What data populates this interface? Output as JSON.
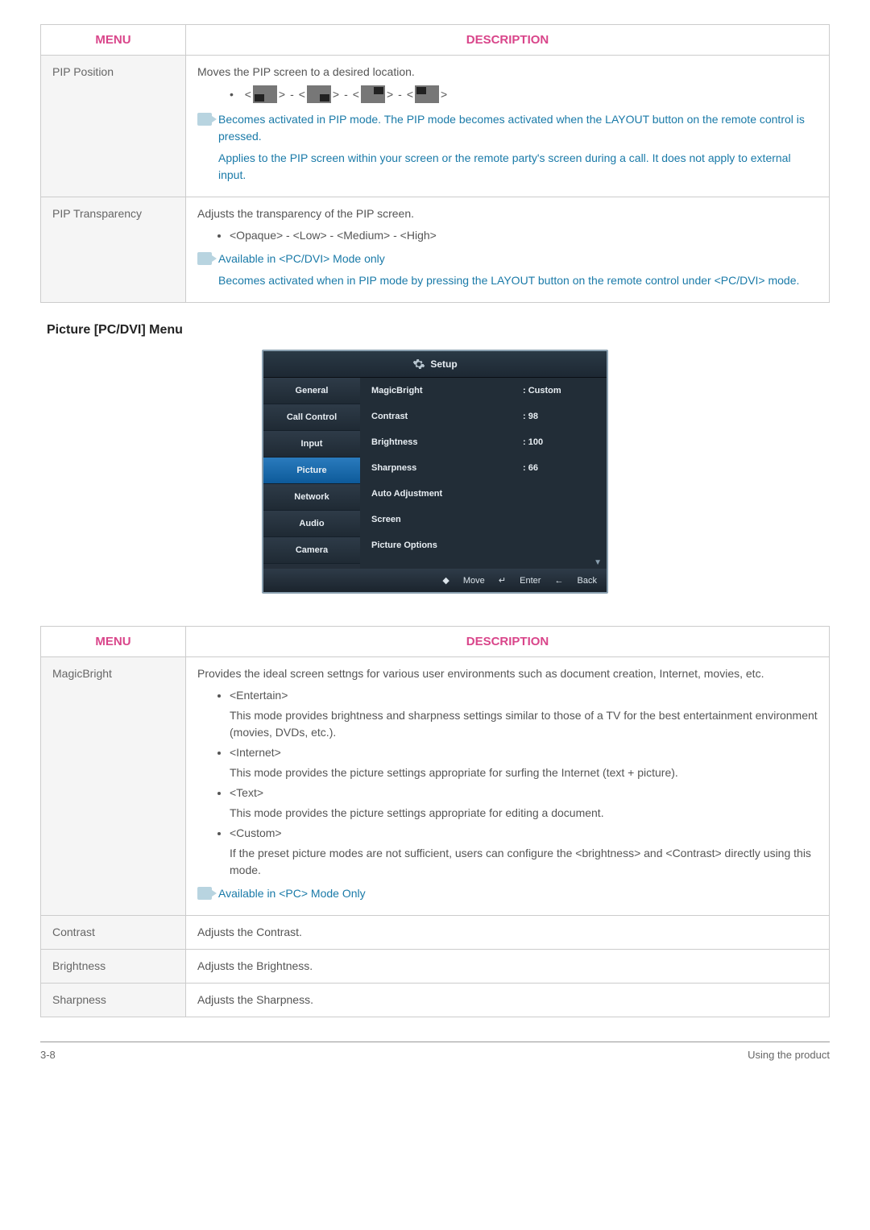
{
  "headers": {
    "menu": "MENU",
    "description": "DESCRIPTION"
  },
  "table1": {
    "rows": [
      {
        "menu": "PIP Position",
        "intro": "Moves the PIP screen to a desired location.",
        "note1": "Becomes activated in PIP mode. The PIP mode becomes activated when the LAYOUT button on the remote control is pressed.",
        "note2": "Applies to the PIP screen within your screen or the remote party's screen during a call. It does not apply to external input."
      },
      {
        "menu": "PIP Transparency",
        "intro": "Adjusts the transparency of the PIP screen.",
        "options": "<Opaque> - <Low> - <Medium> - <High>",
        "note1": "Available in <PC/DVI> Mode only",
        "note2": "Becomes activated when in PIP mode by pressing the LAYOUT button on the remote control under <PC/DVI> mode."
      }
    ]
  },
  "sectionTitle": {
    "pre": "Picture ",
    "mid": "[PC/DVI]",
    "post": " Menu"
  },
  "osd": {
    "title": "Setup",
    "sidebar": [
      "General",
      "Call Control",
      "Input",
      "Picture",
      "Network",
      "Audio",
      "Camera"
    ],
    "activeIndex": 3,
    "rows": [
      {
        "label": "MagicBright",
        "val": ": Custom"
      },
      {
        "label": "Contrast",
        "val": ": 98"
      },
      {
        "label": "Brightness",
        "val": ": 100"
      },
      {
        "label": "Sharpness",
        "val": ": 66"
      },
      {
        "label": "Auto Adjustment",
        "val": ""
      },
      {
        "label": "Screen",
        "val": ""
      },
      {
        "label": "Picture Options",
        "val": ""
      }
    ],
    "footer": {
      "move": "Move",
      "enter": "Enter",
      "back": "Back"
    }
  },
  "table2": {
    "rows": [
      {
        "menu": "MagicBright",
        "intro": "Provides the ideal screen settngs for various user environments such as document creation, Internet, movies, etc.",
        "modes": [
          {
            "title": "<Entertain>",
            "desc": "This mode provides brightness and sharpness settings similar to those of a TV for the best entertainment environment (movies, DVDs, etc.)."
          },
          {
            "title": "<Internet>",
            "desc": "This mode provides the picture settings appropriate for surfing the Internet (text + picture)."
          },
          {
            "title": "<Text>",
            "desc": "This mode provides the picture settings appropriate for editing a document."
          },
          {
            "title": "<Custom>",
            "desc": "If the preset picture modes are not sufficient, users can configure the <brightness> and <Contrast> directly using this mode."
          }
        ],
        "note": "Available in <PC> Mode Only"
      },
      {
        "menu": "Contrast",
        "intro": "Adjusts the Contrast."
      },
      {
        "menu": "Brightness",
        "intro": "Adjusts the Brightness."
      },
      {
        "menu": "Sharpness",
        "intro": "Adjusts the Sharpness."
      }
    ]
  },
  "chart_data": {
    "type": "table",
    "title": "Picture [PC/DVI] Setup OSD values",
    "rows": [
      {
        "setting": "MagicBright",
        "value": "Custom"
      },
      {
        "setting": "Contrast",
        "value": 98
      },
      {
        "setting": "Brightness",
        "value": 100
      },
      {
        "setting": "Sharpness",
        "value": 66
      }
    ]
  },
  "footer": {
    "left": "3-8",
    "right": "Using the product"
  },
  "glyphs": {
    "updown": "◆",
    "enter": "↵",
    "back": "←",
    "scrolldown": "▼",
    "angleL": "<",
    "angleR": ">"
  }
}
